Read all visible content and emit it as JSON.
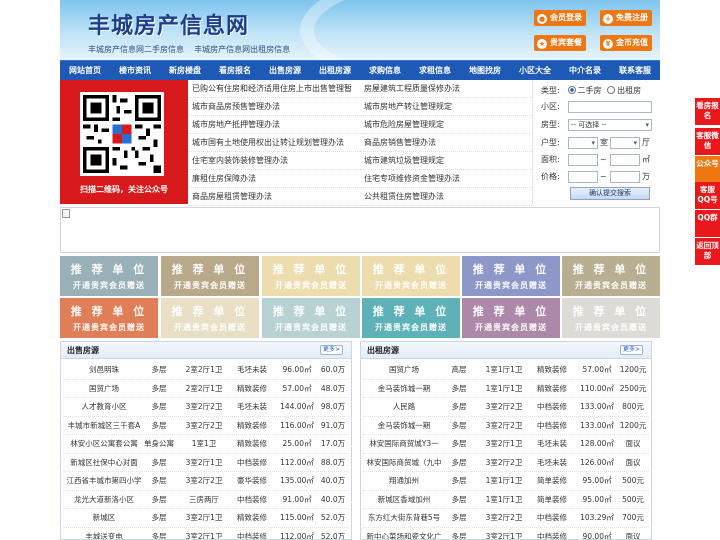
{
  "header": {
    "site_title": "丰城房产信息网",
    "subtitle": "丰城房产信息网二手房信息    丰城房产信息网出租房信息",
    "buttons": [
      {
        "label": "会员登录",
        "icon": "user-icon"
      },
      {
        "label": "免费注册",
        "icon": "register-icon"
      },
      {
        "label": "贵宾套餐",
        "icon": "vip-icon"
      },
      {
        "label": "金币充值",
        "icon": "coin-icon"
      }
    ]
  },
  "nav": [
    "网站首页",
    "楼市资讯",
    "新房楼盘",
    "看房报名",
    "出售房源",
    "出租房源",
    "求购信息",
    "求租信息",
    "地图找房",
    "小区大全",
    "中介名录",
    "联系客服"
  ],
  "qr": {
    "caption": "扫描二维码，关注公众号"
  },
  "news": {
    "left": [
      "已购公有住房和经济适用住房上市出售管理暂",
      "城市商品房预售管理办法",
      "城市房地产抵押管理办法",
      "城市国有土地使用权出让转让规划管理办法",
      "住宅室内装饰装修管理办法",
      "廉租住房保障办法",
      "商品房屋租赁管理办法"
    ],
    "right": [
      "房屋建筑工程质量保修办法",
      "城市房地产转让管理规定",
      "城市危险房屋管理规定",
      "商品房销售管理办法",
      "城市建筑垃圾管理规定",
      "住宅专项维修资金管理办法",
      "公共租赁住房管理办法"
    ]
  },
  "search": {
    "type_label": "类型:",
    "type_options": [
      "二手房",
      "出租房"
    ],
    "community_label": "小区:",
    "house_type_label": "房型:",
    "house_type_value": "-- 可选择 --",
    "layout_label": "户型:",
    "room_unit": "室",
    "hall_unit": "厅",
    "area_label": "面积:",
    "area_unit": "㎡",
    "price_label": "价格:",
    "price_unit": "万",
    "range_sep": "~",
    "submit_label": "确认提交搜索"
  },
  "recommend": {
    "line1": "推 荐 单 位",
    "line2": "开通贵宾会员赠送",
    "colors": [
      "#9ab0b8",
      "#b9a98b",
      "#ecdcae",
      "#ecdcae",
      "#8d97c8",
      "#b8af92",
      "#e07e57",
      "#e8dfc4",
      "#b8d2d4",
      "#5eb2b7",
      "#ad88a8",
      "#dcdbd5"
    ]
  },
  "sale": {
    "title": "出售房源",
    "more": "更多>",
    "rows": [
      [
        "剑邑明珠",
        "多层",
        "2室2厅1卫",
        "毛坯未装",
        "96.00㎡",
        "60.0万"
      ],
      [
        "国贸广场",
        "多层",
        "2室2厅1卫",
        "精致装修",
        "57.00㎡",
        "48.0万"
      ],
      [
        "人才教育小区",
        "多层",
        "3室2厅2卫",
        "毛坯未装",
        "144.00㎡",
        "98.0万"
      ],
      [
        "丰城市新城区三千套A",
        "多层",
        "3室2厅2卫",
        "精致装修",
        "116.00㎡",
        "91.0万"
      ],
      [
        "林安小区公寓套公寓",
        "单身公寓",
        "1室1卫",
        "精致装修",
        "25.00㎡",
        "17.0万"
      ],
      [
        "新城区社保中心对面",
        "多层",
        "3室2厅1卫",
        "中档装修",
        "112.00㎡",
        "88.0万"
      ],
      [
        "江西省丰城市第四小学",
        "多层",
        "3室2厅2卫",
        "豪华装修",
        "135.00㎡",
        "40.0万"
      ],
      [
        "龙光大道新洛小区",
        "多层",
        "三房两厅",
        "中档装修",
        "91.00㎡",
        "40.0万"
      ],
      [
        "新城区",
        "多层",
        "3室2厅1卫",
        "精致装修",
        "115.00㎡",
        "52.0万"
      ],
      [
        "丰城送变电",
        "多层",
        "3室2厅1卫",
        "中档装修",
        "112.00㎡",
        "52.0万"
      ]
    ]
  },
  "rent": {
    "title": "出租房源",
    "more": "更多>",
    "rows": [
      [
        "国贸广场",
        "高层",
        "1室1厅1卫",
        "精致装修",
        "57.00㎡",
        "1200元"
      ],
      [
        "金马装饰城一期",
        "多层",
        "1室1厅1卫",
        "精致装修",
        "110.00㎡",
        "2500元"
      ],
      [
        "人民路",
        "多层",
        "3室2厅2卫",
        "中档装修",
        "133.00㎡",
        "800元"
      ],
      [
        "金马装饰城一期",
        "多层",
        "3室2厅2卫",
        "中档装修",
        "133.00㎡",
        "1200元"
      ],
      [
        "林安国际商贸城Y3一",
        "多层",
        "3室2厅1卫",
        "毛坯未装",
        "128.00㎡",
        "面议"
      ],
      [
        "林安国际商贸城（九中",
        "多层",
        "3室2厅2卫",
        "毛坯未装",
        "126.00㎡",
        "面议"
      ],
      [
        "翔通加州",
        "多层",
        "1室1厅1卫",
        "简单装修",
        "95.00㎡",
        "500元"
      ],
      [
        "新城区香域加州",
        "多层",
        "1室1厅1卫",
        "简单装修",
        "95.00㎡",
        "500元"
      ],
      [
        "东方红大街东背巷5号",
        "多层",
        "3室2厅2卫",
        "中档装修",
        "103.29㎡",
        "700元"
      ],
      [
        "新中心菜场和瓷文化广",
        "多层",
        "3室2厅1卫",
        "中档装修",
        "90.00㎡",
        "面议"
      ]
    ]
  },
  "side": [
    "看房报名",
    "客服微信",
    "公众号",
    "客服QQ号",
    "QQ群",
    "返回顶部"
  ]
}
